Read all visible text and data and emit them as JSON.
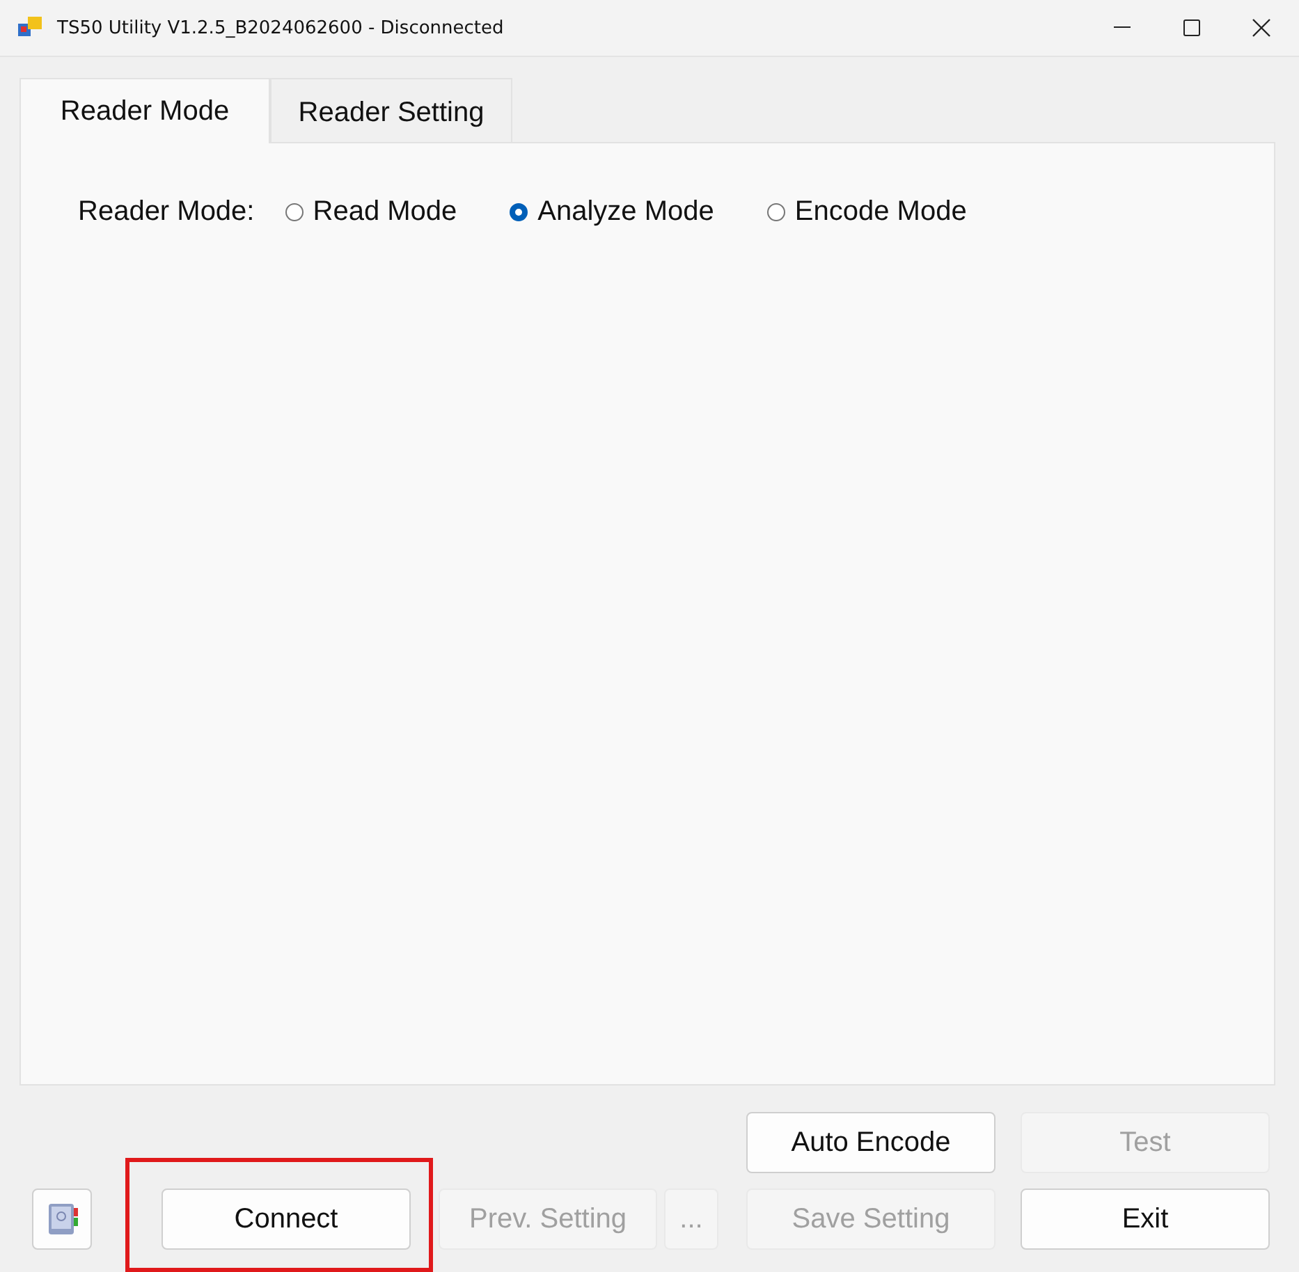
{
  "window": {
    "title": "TS50 Utility V1.2.5_B2024062600 - Disconnected"
  },
  "tabs": [
    {
      "label": "Reader Mode",
      "selected": true
    },
    {
      "label": "Reader Setting",
      "selected": false
    }
  ],
  "reader_mode": {
    "label": "Reader Mode:",
    "options": [
      {
        "label": "Read Mode",
        "selected": false
      },
      {
        "label": "Analyze Mode",
        "selected": true
      },
      {
        "label": "Encode Mode",
        "selected": false
      }
    ]
  },
  "top_buttons": [
    {
      "label": "Auto Encode",
      "disabled": false
    },
    {
      "label": "Test",
      "disabled": true
    }
  ],
  "bottom_buttons": [
    {
      "label": "Connect",
      "disabled": false,
      "highlighted": true
    },
    {
      "label": "Prev. Setting",
      "disabled": true,
      "highlighted": false
    },
    {
      "label": "...",
      "disabled": true,
      "highlighted": false
    },
    {
      "label": "Save Setting",
      "disabled": true,
      "highlighted": false
    },
    {
      "label": "Exit",
      "disabled": false,
      "highlighted": false
    }
  ]
}
